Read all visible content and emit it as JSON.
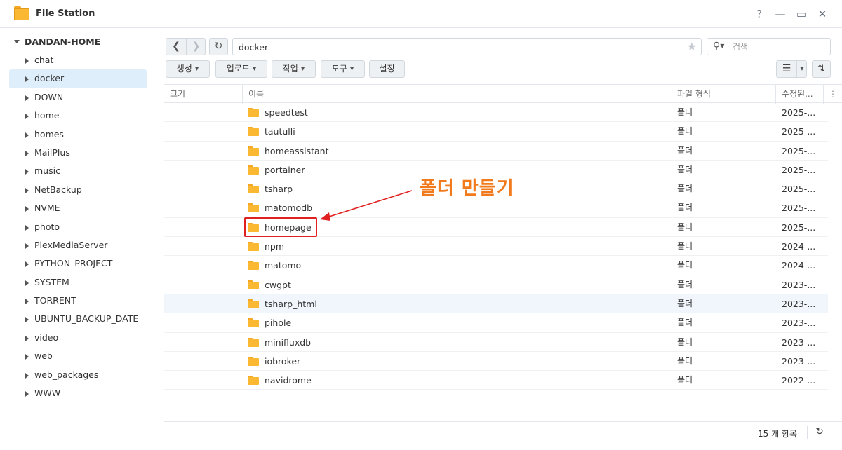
{
  "window": {
    "title": "File Station",
    "controls": {
      "help": "?",
      "minimize": "—",
      "maximize": "▭",
      "close": "✕"
    }
  },
  "sidebar": {
    "root": "DANDAN-HOME",
    "items": [
      {
        "label": "chat"
      },
      {
        "label": "docker"
      },
      {
        "label": "DOWN"
      },
      {
        "label": "home"
      },
      {
        "label": "homes"
      },
      {
        "label": "MailPlus"
      },
      {
        "label": "music"
      },
      {
        "label": "NetBackup"
      },
      {
        "label": "NVME"
      },
      {
        "label": "photo"
      },
      {
        "label": "PlexMediaServer"
      },
      {
        "label": "PYTHON_PROJECT"
      },
      {
        "label": "SYSTEM"
      },
      {
        "label": "TORRENT"
      },
      {
        "label": "UBUNTU_BACKUP_DATE"
      },
      {
        "label": "video"
      },
      {
        "label": "web"
      },
      {
        "label": "web_packages"
      },
      {
        "label": "WWW"
      }
    ],
    "selected": "docker"
  },
  "toolbar": {
    "path": "docker",
    "search_placeholder": "검색",
    "buttons": {
      "create": "생성",
      "upload": "업로드",
      "action": "작업",
      "tools": "도구",
      "settings": "설정"
    }
  },
  "table": {
    "headers": {
      "size": "크기",
      "name": "이름",
      "type": "파일 형식",
      "modified": "수정된..."
    },
    "rows": [
      {
        "name": "speedtest",
        "type": "폴더",
        "date": "2025-..."
      },
      {
        "name": "tautulli",
        "type": "폴더",
        "date": "2025-..."
      },
      {
        "name": "homeassistant",
        "type": "폴더",
        "date": "2025-..."
      },
      {
        "name": "portainer",
        "type": "폴더",
        "date": "2025-..."
      },
      {
        "name": "tsharp",
        "type": "폴더",
        "date": "2025-..."
      },
      {
        "name": "matomodb",
        "type": "폴더",
        "date": "2025-..."
      },
      {
        "name": "homepage",
        "type": "폴더",
        "date": "2025-..."
      },
      {
        "name": "npm",
        "type": "폴더",
        "date": "2024-..."
      },
      {
        "name": "matomo",
        "type": "폴더",
        "date": "2024-..."
      },
      {
        "name": "cwgpt",
        "type": "폴더",
        "date": "2023-..."
      },
      {
        "name": "tsharp_html",
        "type": "폴더",
        "date": "2023-..."
      },
      {
        "name": "pihole",
        "type": "폴더",
        "date": "2023-..."
      },
      {
        "name": "minifluxdb",
        "type": "폴더",
        "date": "2023-..."
      },
      {
        "name": "iobroker",
        "type": "폴더",
        "date": "2023-..."
      },
      {
        "name": "navidrome",
        "type": "폴더",
        "date": "2022-..."
      }
    ]
  },
  "annotation": {
    "text": "폴더 만들기",
    "color": "#f07a1c",
    "box_color": "#e02020"
  },
  "footer": {
    "count": "15 개 항목"
  },
  "colors": {
    "folder": "#fbb832",
    "selected": "#dfeefb",
    "accent": "#f07a1c"
  }
}
